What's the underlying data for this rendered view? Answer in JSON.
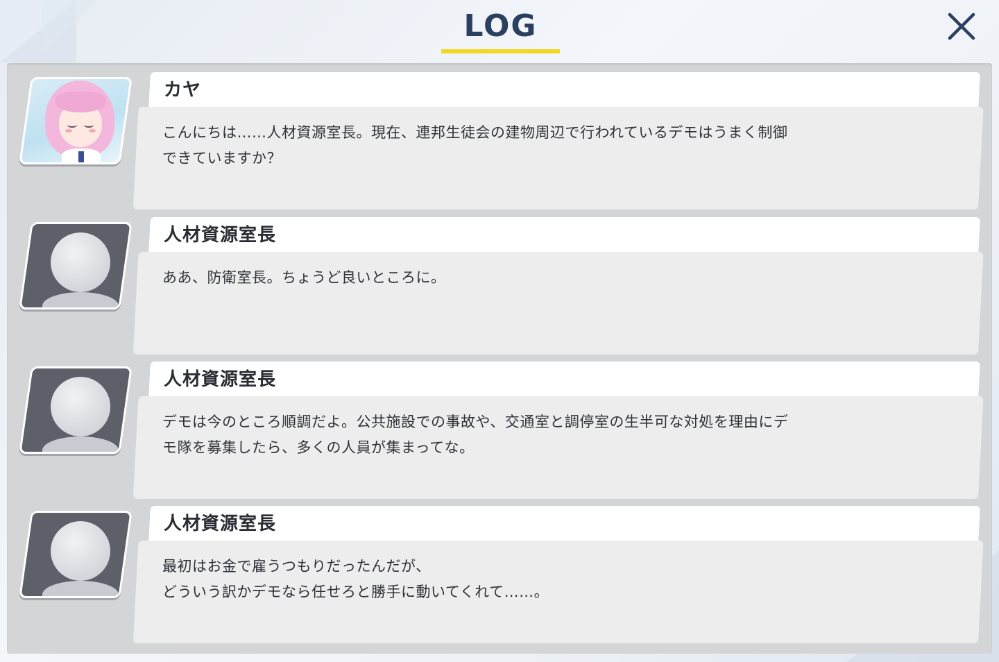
{
  "header": {
    "title": "LOG",
    "close_icon": "close-icon"
  },
  "entries": [
    {
      "speaker": "カヤ",
      "avatar": "kaya-portrait",
      "text": "こんにちは……人材資源室長。現在、連邦生徒会の建物周辺で行われているデモはうまく制御\nできていますか？"
    },
    {
      "speaker": "人材資源室長",
      "avatar": "silhouette-placeholder",
      "text": "ああ、防衛室長。ちょうど良いところに。"
    },
    {
      "speaker": "人材資源室長",
      "avatar": "silhouette-placeholder",
      "text": "デモは今のところ順調だよ。公共施設での事故や、交通室と調停室の生半可な対処を理由にデ\nモ隊を募集したら、多くの人員が集まってな。"
    },
    {
      "speaker": "人材資源室長",
      "avatar": "silhouette-placeholder",
      "text": "最初はお金で雇うつもりだったんだが、\nどういう訳かデモなら任せろと勝手に動いてくれて……。"
    }
  ],
  "colors": {
    "title": "#2b3f5e",
    "accent_underline": "#f2d81f",
    "panel": "#d4d5d6",
    "message_box": "#ededed"
  }
}
